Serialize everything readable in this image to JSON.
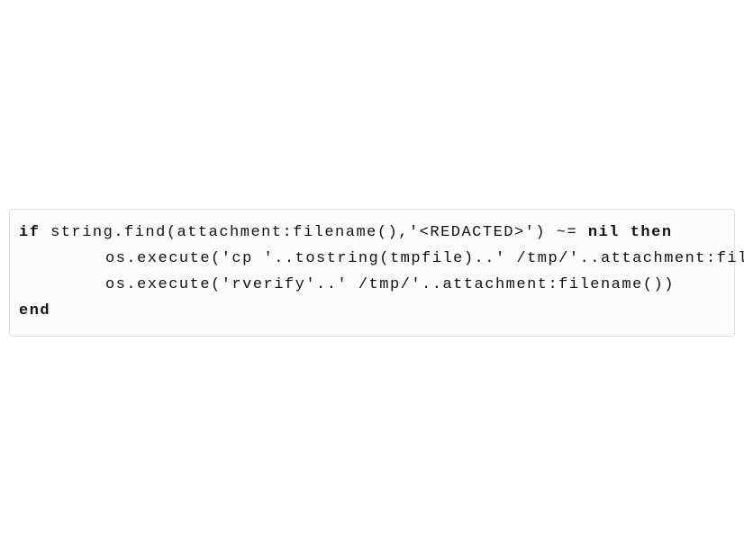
{
  "code": {
    "line1": {
      "kw_if": "if",
      "mid": " string.find(attachment:filename(),'<REDACTED>') ~= ",
      "kw_nil": "nil",
      "sp": " ",
      "kw_then": "then"
    },
    "line2": "os.execute('cp '..tostring(tmpfile)..' /tmp/'..attachment:filename())",
    "line3": "os.execute('rverify'..' /tmp/'..attachment:filename())",
    "line4": "end"
  }
}
